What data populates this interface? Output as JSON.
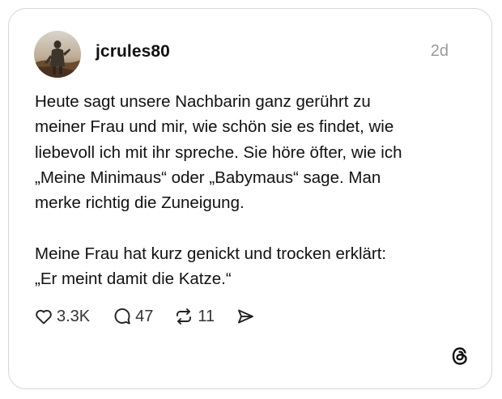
{
  "post": {
    "author": "jcrules80",
    "time": "2d",
    "text_lines": [
      "Heute sagt unsere Nachbarin ganz gerührt zu",
      "meiner Frau und mir, wie schön sie es findet, wie",
      "liebevoll ich mit ihr spreche. Sie höre öfter, wie ich",
      "„Meine Minimaus“ oder „Babymaus“ sage. Man",
      "merke richtig die Zuneigung.",
      "",
      "Meine Frau hat kurz genickt und trocken erklärt:",
      "„Er meint damit die Katze.“"
    ]
  },
  "actions": {
    "likes": "3.3K",
    "replies": "47",
    "reposts": "11"
  },
  "icons": {
    "like": "heart-icon",
    "reply": "speech-bubble-icon",
    "repost": "repost-icon",
    "share": "send-icon",
    "brand": "threads-logo-icon"
  }
}
